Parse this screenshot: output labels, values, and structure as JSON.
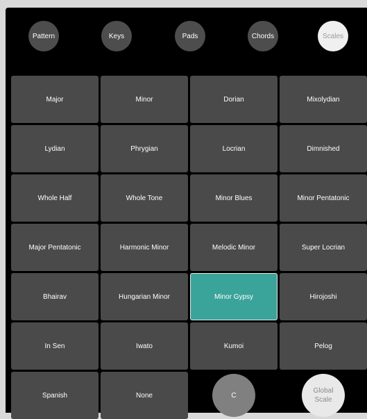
{
  "tabs": [
    {
      "label": "Pattern",
      "active": false
    },
    {
      "label": "Keys",
      "active": false
    },
    {
      "label": "Pads",
      "active": false
    },
    {
      "label": "Chords",
      "active": false
    },
    {
      "label": "Scales",
      "active": true
    }
  ],
  "scales": [
    "Major",
    "Minor",
    "Dorian",
    "Mixolydian",
    "Lydian",
    "Phrygian",
    "Locrian",
    "Dimnished",
    "Whole Half",
    "Whole Tone",
    "Minor Blues",
    "Minor Pentatonic",
    "Major Pentatonic",
    "Harmonic Minor",
    "Melodic Minor",
    "Super Locrian",
    "Bhairav",
    "Hungarian Minor",
    "Minor Gypsy",
    "Hirojoshi",
    "In Sen",
    "Iwato",
    "Kumoi",
    "Pelog",
    "Spanish",
    "None"
  ],
  "selected_scale": "Minor Gypsy",
  "key_button": {
    "label": "C"
  },
  "global_scale_button": {
    "line1": "Global",
    "line2": "Scale"
  },
  "colors": {
    "background": "#000000",
    "button": "#4a4a4a",
    "selected": "#3aa39a",
    "active_tab": "#f0f0f0"
  }
}
